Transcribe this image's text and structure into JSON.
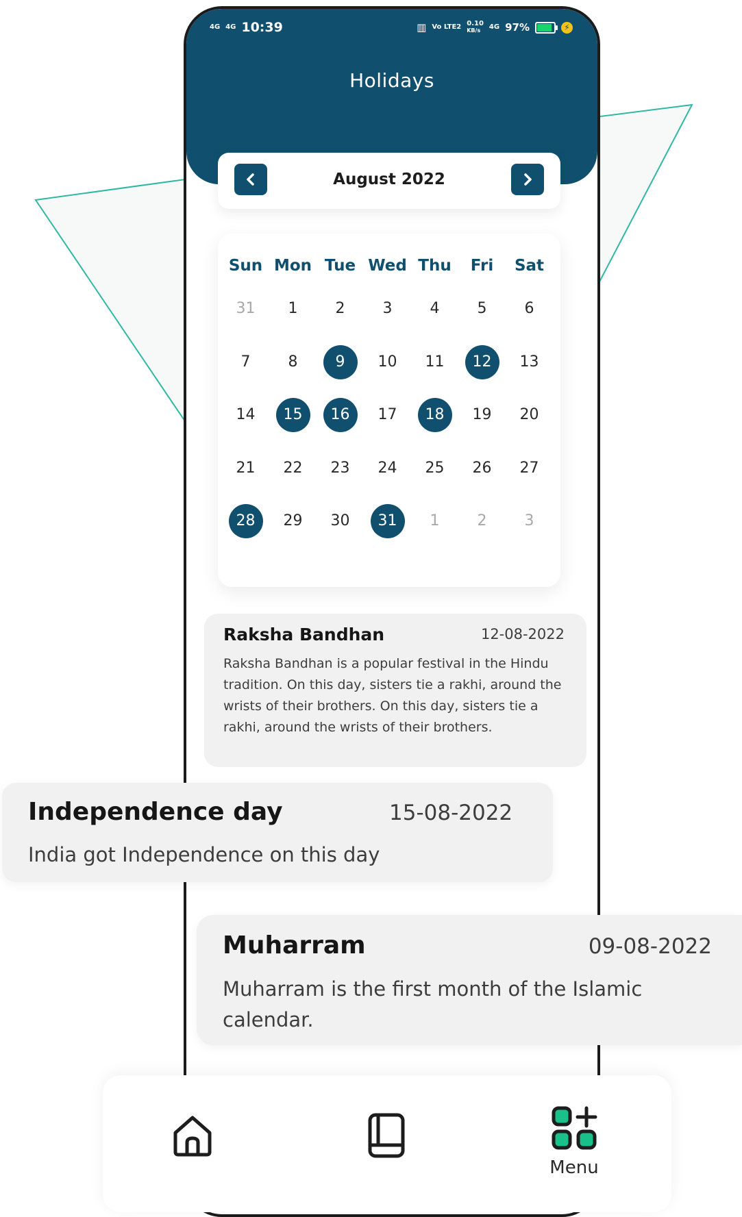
{
  "status_bar": {
    "time": "10:39",
    "net_left_1": "4G",
    "net_left_2": "4G",
    "volte": "Vo LTE2",
    "speed": "0.10",
    "speed_unit": "KB/s",
    "net_right": "4G",
    "battery": "97%",
    "battery_level_percent": 97
  },
  "header": {
    "title": "Holidays"
  },
  "month_nav": {
    "label": "August 2022",
    "prev_icon": "chevron-left-icon",
    "next_icon": "chevron-right-icon"
  },
  "calendar": {
    "weekdays": [
      "Sun",
      "Mon",
      "Tue",
      "Wed",
      "Thu",
      "Fri",
      "Sat"
    ],
    "weeks": [
      [
        {
          "d": "31",
          "other": true
        },
        {
          "d": "1"
        },
        {
          "d": "2"
        },
        {
          "d": "3"
        },
        {
          "d": "4"
        },
        {
          "d": "5"
        },
        {
          "d": "6"
        }
      ],
      [
        {
          "d": "7"
        },
        {
          "d": "8"
        },
        {
          "d": "9",
          "holiday": true
        },
        {
          "d": "10"
        },
        {
          "d": "11"
        },
        {
          "d": "12",
          "holiday": true
        },
        {
          "d": "13"
        }
      ],
      [
        {
          "d": "14"
        },
        {
          "d": "15",
          "holiday": true
        },
        {
          "d": "16",
          "holiday": true
        },
        {
          "d": "17"
        },
        {
          "d": "18",
          "holiday": true
        },
        {
          "d": "19"
        },
        {
          "d": "20"
        }
      ],
      [
        {
          "d": "21"
        },
        {
          "d": "22"
        },
        {
          "d": "23"
        },
        {
          "d": "24"
        },
        {
          "d": "25"
        },
        {
          "d": "26"
        },
        {
          "d": "27"
        }
      ],
      [
        {
          "d": "28",
          "holiday": true
        },
        {
          "d": "29"
        },
        {
          "d": "30"
        },
        {
          "d": "31",
          "holiday": true
        },
        {
          "d": "1",
          "other": true
        },
        {
          "d": "2",
          "other": true
        },
        {
          "d": "3",
          "other": true
        }
      ]
    ]
  },
  "holidays": [
    {
      "name": "Raksha Bandhan",
      "date": "12-08-2022",
      "description": "Raksha Bandhan is a popular festival in the Hindu tradition.  On this day, sisters tie a rakhi, around the wrists of their brothers. On this day, sisters tie a rakhi, around the wrists of their brothers."
    },
    {
      "name": "Independence day",
      "date": "15-08-2022",
      "description": "India got Independence on this day"
    },
    {
      "name": "Muharram",
      "date": "09-08-2022",
      "description": "Muharram is the first month of the Islamic calendar."
    }
  ],
  "bottom_nav": {
    "items": [
      {
        "icon": "home-icon",
        "label": ""
      },
      {
        "icon": "book-icon",
        "label": ""
      },
      {
        "icon": "menu-grid-icon",
        "label": "Menu"
      }
    ]
  },
  "colors": {
    "primary": "#10506e",
    "accent": "#19c08a",
    "card_bg": "#f1f1f1",
    "deco_line": "#2fb9a2"
  }
}
